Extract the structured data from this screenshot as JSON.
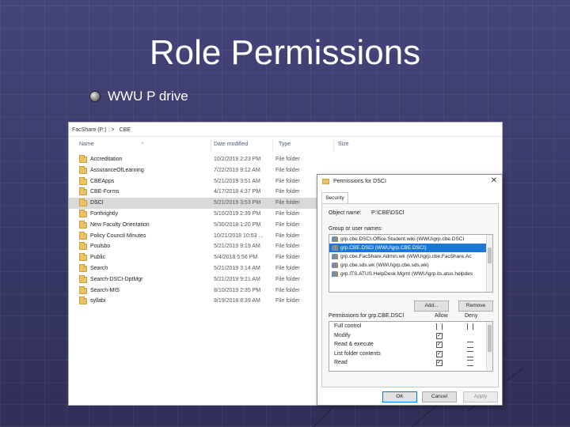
{
  "slide": {
    "title": "Role Permissions",
    "bullet": "WWU P drive"
  },
  "explorer": {
    "breadcrumb": [
      "FacShare (P:)",
      ">",
      "CBE"
    ],
    "columns": {
      "name": "Name",
      "date": "Date modified",
      "type": "Type",
      "size": "Size"
    },
    "rows": [
      {
        "name": "Accreditation",
        "date": "10/2/2019 2:23 PM",
        "type": "File folder",
        "selected": false
      },
      {
        "name": "AssuranceOfLearning",
        "date": "7/22/2019 9:12 AM",
        "type": "File folder",
        "selected": false
      },
      {
        "name": "CBEApps",
        "date": "5/21/2019 3:51 AM",
        "type": "File folder",
        "selected": false
      },
      {
        "name": "CBE-Forms",
        "date": "4/17/2018 4:37 PM",
        "type": "File folder",
        "selected": false
      },
      {
        "name": "DSCI",
        "date": "5/21/2019 3:53 PM",
        "type": "File folder",
        "selected": true
      },
      {
        "name": "Forthrightly",
        "date": "5/10/2019 2:39 PM",
        "type": "File folder",
        "selected": false
      },
      {
        "name": "New Faculty Orientation",
        "date": "5/30/2018 1:20 PM",
        "type": "File folder",
        "selected": false
      },
      {
        "name": "Policy Council Minutes",
        "date": "10/21/2018 10:53 ...",
        "type": "File folder",
        "selected": false
      },
      {
        "name": "Poulsbo",
        "date": "5/21/2019 9:19 AM",
        "type": "File folder",
        "selected": false
      },
      {
        "name": "Public",
        "date": "5/4/2018 5:56 PM",
        "type": "File folder",
        "selected": false
      },
      {
        "name": "Search",
        "date": "5/21/2019 3:14 AM",
        "type": "File folder",
        "selected": false
      },
      {
        "name": "Search-DSCI-DptMgr",
        "date": "5/21/2019 9:21 AM",
        "type": "File folder",
        "selected": false
      },
      {
        "name": "Search-MIS",
        "date": "8/10/2019 2:35 PM",
        "type": "File folder",
        "selected": false
      },
      {
        "name": "syllabi",
        "date": "9/19/2018 8:39 AM",
        "type": "File folder",
        "selected": false
      }
    ]
  },
  "dialog": {
    "title": "Permissions for DSCI",
    "close_icon": "close-icon",
    "tab_security": "Security",
    "object_name_label": "Object name:",
    "object_name_value": "P:\\CBE\\DSCI",
    "group_label": "Group or user names:",
    "groups": [
      {
        "text": "grp.cbe.DSCI.Office.Student.wiki (WWU\\grp.cbe.DSCI",
        "selected": false
      },
      {
        "text": "grp.CBE.DSCI (WWU\\grp.CBE.DSCI)",
        "selected": true
      },
      {
        "text": "grp.cbe.FacShare.Admin.wk (WWU\\grp.cbe.FacShare.Ac",
        "selected": false
      },
      {
        "text": "grp.cbe.sds.wk (WWU\\grp.cbe.sds.wk)",
        "selected": false
      },
      {
        "text": "grp.ITS.ATUS.HelpDesk.Mgmt (WWU\\grp.its.atus.helpdes",
        "selected": false
      }
    ],
    "add_label": "Add...",
    "remove_label": "Remove",
    "permissions_label": "Permissions for grp.CBE.DSCI",
    "allow_label": "Allow",
    "deny_label": "Deny",
    "permissions": [
      {
        "name": "Full control",
        "allow": false,
        "allow_style": "tall",
        "deny_style": "tall"
      },
      {
        "name": "Modify",
        "allow": true,
        "allow_style": "box",
        "deny_style": "none"
      },
      {
        "name": "Read & execute",
        "allow": true,
        "allow_style": "box",
        "deny_style": "box"
      },
      {
        "name": "List folder contents",
        "allow": true,
        "allow_style": "box",
        "deny_style": "box"
      },
      {
        "name": "Read",
        "allow": true,
        "allow_style": "box",
        "deny_style": "box"
      }
    ],
    "ok_label": "OK",
    "cancel_label": "Cancel",
    "apply_label": "Apply"
  },
  "colors": {
    "slide_background": "#3a3a6a",
    "selection_blue": "#1a78d7",
    "folder_yellow": "#e9c466"
  }
}
